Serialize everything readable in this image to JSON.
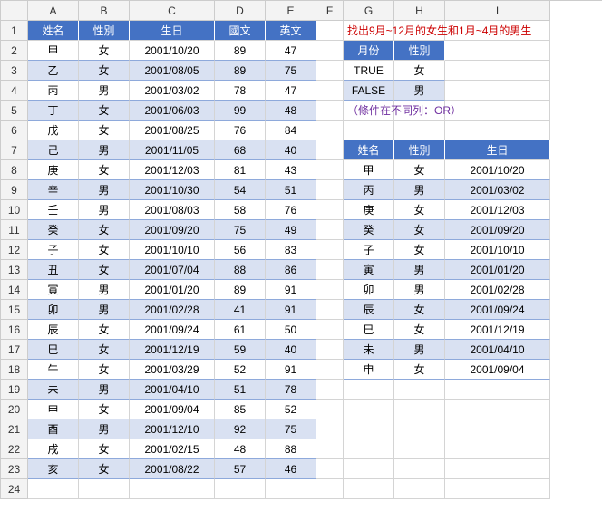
{
  "columns": [
    "",
    "A",
    "B",
    "C",
    "D",
    "E",
    "F",
    "G",
    "H",
    "I"
  ],
  "rowCount": 24,
  "main": {
    "headers": [
      "姓名",
      "性別",
      "生日",
      "國文",
      "英文"
    ],
    "rows": [
      [
        "甲",
        "女",
        "2001/10/20",
        "89",
        "47"
      ],
      [
        "乙",
        "女",
        "2001/08/05",
        "89",
        "75"
      ],
      [
        "丙",
        "男",
        "2001/03/02",
        "78",
        "47"
      ],
      [
        "丁",
        "女",
        "2001/06/03",
        "99",
        "48"
      ],
      [
        "戊",
        "女",
        "2001/08/25",
        "76",
        "84"
      ],
      [
        "己",
        "男",
        "2001/11/05",
        "68",
        "40"
      ],
      [
        "庚",
        "女",
        "2001/12/03",
        "81",
        "43"
      ],
      [
        "辛",
        "男",
        "2001/10/30",
        "54",
        "51"
      ],
      [
        "壬",
        "男",
        "2001/08/03",
        "58",
        "76"
      ],
      [
        "癸",
        "女",
        "2001/09/20",
        "75",
        "49"
      ],
      [
        "子",
        "女",
        "2001/10/10",
        "56",
        "83"
      ],
      [
        "丑",
        "女",
        "2001/07/04",
        "88",
        "86"
      ],
      [
        "寅",
        "男",
        "2001/01/20",
        "89",
        "91"
      ],
      [
        "卯",
        "男",
        "2001/02/28",
        "41",
        "91"
      ],
      [
        "辰",
        "女",
        "2001/09/24",
        "61",
        "50"
      ],
      [
        "巳",
        "女",
        "2001/12/19",
        "59",
        "40"
      ],
      [
        "午",
        "女",
        "2001/03/29",
        "52",
        "91"
      ],
      [
        "未",
        "男",
        "2001/04/10",
        "51",
        "78"
      ],
      [
        "申",
        "女",
        "2001/09/04",
        "85",
        "52"
      ],
      [
        "酉",
        "男",
        "2001/12/10",
        "92",
        "75"
      ],
      [
        "戌",
        "女",
        "2001/02/15",
        "48",
        "88"
      ],
      [
        "亥",
        "女",
        "2001/08/22",
        "57",
        "46"
      ]
    ]
  },
  "note1": "找出9月~12月的女生和1月~4月的男生",
  "criteria": {
    "headers": [
      "月份",
      "性別"
    ],
    "rows": [
      [
        "TRUE",
        "女"
      ],
      [
        "FALSE",
        "男"
      ]
    ]
  },
  "note2": "（條件在不同列：OR）",
  "result": {
    "headers": [
      "姓名",
      "性別",
      "生日"
    ],
    "rows": [
      [
        "甲",
        "女",
        "2001/10/20"
      ],
      [
        "丙",
        "男",
        "2001/03/02"
      ],
      [
        "庚",
        "女",
        "2001/12/03"
      ],
      [
        "癸",
        "女",
        "2001/09/20"
      ],
      [
        "子",
        "女",
        "2001/10/10"
      ],
      [
        "寅",
        "男",
        "2001/01/20"
      ],
      [
        "卯",
        "男",
        "2001/02/28"
      ],
      [
        "辰",
        "女",
        "2001/09/24"
      ],
      [
        "巳",
        "女",
        "2001/12/19"
      ],
      [
        "未",
        "男",
        "2001/04/10"
      ],
      [
        "申",
        "女",
        "2001/09/04"
      ]
    ]
  },
  "chart_data": {
    "type": "table",
    "title": "找出9月~12月的女生和1月~4月的男生",
    "source_columns": [
      "姓名",
      "性別",
      "生日",
      "國文",
      "英文"
    ],
    "source_rows": [
      [
        "甲",
        "女",
        "2001/10/20",
        89,
        47
      ],
      [
        "乙",
        "女",
        "2001/08/05",
        89,
        75
      ],
      [
        "丙",
        "男",
        "2001/03/02",
        78,
        47
      ],
      [
        "丁",
        "女",
        "2001/06/03",
        99,
        48
      ],
      [
        "戊",
        "女",
        "2001/08/25",
        76,
        84
      ],
      [
        "己",
        "男",
        "2001/11/05",
        68,
        40
      ],
      [
        "庚",
        "女",
        "2001/12/03",
        81,
        43
      ],
      [
        "辛",
        "男",
        "2001/10/30",
        54,
        51
      ],
      [
        "壬",
        "男",
        "2001/08/03",
        58,
        76
      ],
      [
        "癸",
        "女",
        "2001/09/20",
        75,
        49
      ],
      [
        "子",
        "女",
        "2001/10/10",
        56,
        83
      ],
      [
        "丑",
        "女",
        "2001/07/04",
        88,
        86
      ],
      [
        "寅",
        "男",
        "2001/01/20",
        89,
        91
      ],
      [
        "卯",
        "男",
        "2001/02/28",
        41,
        91
      ],
      [
        "辰",
        "女",
        "2001/09/24",
        61,
        50
      ],
      [
        "巳",
        "女",
        "2001/12/19",
        59,
        40
      ],
      [
        "午",
        "女",
        "2001/03/29",
        52,
        91
      ],
      [
        "未",
        "男",
        "2001/04/10",
        51,
        78
      ],
      [
        "申",
        "女",
        "2001/09/04",
        85,
        52
      ],
      [
        "酉",
        "男",
        "2001/12/10",
        92,
        75
      ],
      [
        "戌",
        "女",
        "2001/02/15",
        48,
        88
      ],
      [
        "亥",
        "女",
        "2001/08/22",
        57,
        46
      ]
    ],
    "criteria": {
      "月份": [
        "TRUE",
        "FALSE"
      ],
      "性別": [
        "女",
        "男"
      ],
      "logic": "OR"
    },
    "result_columns": [
      "姓名",
      "性別",
      "生日"
    ],
    "result_rows": [
      [
        "甲",
        "女",
        "2001/10/20"
      ],
      [
        "丙",
        "男",
        "2001/03/02"
      ],
      [
        "庚",
        "女",
        "2001/12/03"
      ],
      [
        "癸",
        "女",
        "2001/09/20"
      ],
      [
        "子",
        "女",
        "2001/10/10"
      ],
      [
        "寅",
        "男",
        "2001/01/20"
      ],
      [
        "卯",
        "男",
        "2001/02/28"
      ],
      [
        "辰",
        "女",
        "2001/09/24"
      ],
      [
        "巳",
        "女",
        "2001/12/19"
      ],
      [
        "未",
        "男",
        "2001/04/10"
      ],
      [
        "申",
        "女",
        "2001/09/04"
      ]
    ]
  }
}
